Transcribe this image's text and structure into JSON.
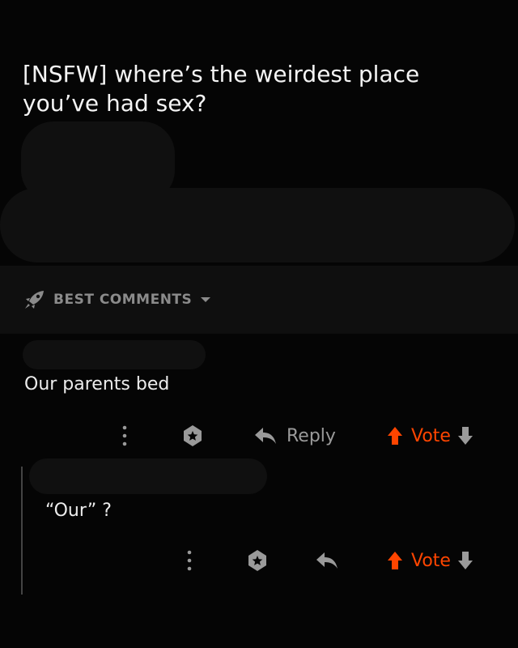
{
  "post": {
    "title": "[NSFW] where’s the weirdest place you’ve had sex?"
  },
  "sort": {
    "label": "BEST COMMENTS",
    "icon": "rocket-icon"
  },
  "comments": [
    {
      "body": "Our parents bed",
      "actions": {
        "reply_label": "Reply",
        "vote_label": "Vote"
      }
    },
    {
      "body": "“Our” ?",
      "actions": {
        "vote_label": "Vote"
      }
    }
  ],
  "colors": {
    "background": "#050505",
    "accent_upvote": "#ff4500",
    "muted_text": "#9a9a9a"
  }
}
